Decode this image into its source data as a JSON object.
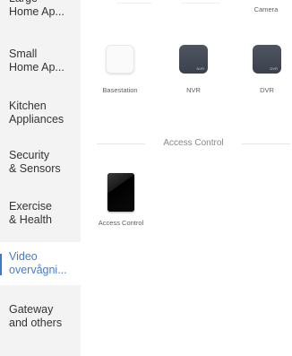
{
  "sidebar": {
    "items": [
      {
        "label": "Large\nHome Ap...",
        "active": false
      },
      {
        "label": "Small\nHome Ap...",
        "active": false
      },
      {
        "label": "Kitchen\nAppliances",
        "active": false
      },
      {
        "label": "Security\n& Sensors",
        "active": false
      },
      {
        "label": "Exercise\n& Health",
        "active": false
      },
      {
        "label": "Video\novervågni...",
        "active": true
      },
      {
        "label": "Gateway\nand others",
        "active": false
      }
    ]
  },
  "main": {
    "top_row": {
      "camera_label": "Camera"
    },
    "devices": [
      {
        "label": "Basestation",
        "style": "white"
      },
      {
        "label": "NVR",
        "style": "dark",
        "tag": "NVR"
      },
      {
        "label": "DVR",
        "style": "dark",
        "tag": "DVR"
      }
    ],
    "access_section": {
      "title": "Access Control",
      "devices": [
        {
          "label": "Access Control"
        }
      ]
    }
  },
  "colors": {
    "accent": "#3f78c8",
    "sidebar_bg": "#f3f3f4",
    "text": "#333333",
    "muted": "#888888"
  }
}
